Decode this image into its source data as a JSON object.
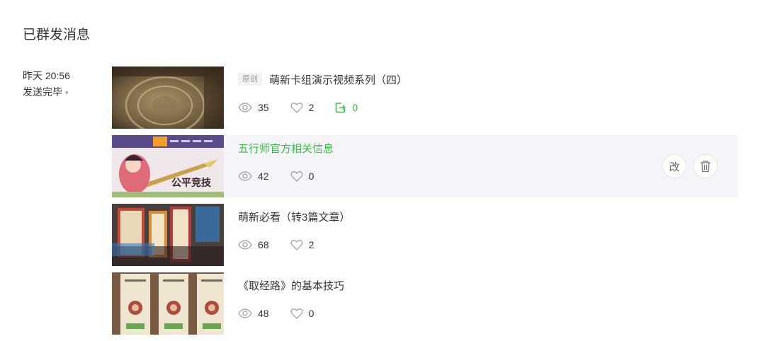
{
  "page": {
    "title": "已群发消息"
  },
  "meta": {
    "time": "昨天 20:56",
    "status": "发送完毕"
  },
  "articles": [
    {
      "tag": "原创",
      "title": "萌新卡组演示视频系列（四）",
      "views": "35",
      "likes": "2",
      "shares": "0"
    },
    {
      "title": "五行师官方相关信息",
      "views": "42",
      "likes": "0",
      "edit_label": "改"
    },
    {
      "title": "萌新必看（转3篇文章）",
      "views": "68",
      "likes": "2"
    },
    {
      "title": "《取经路》的基本技巧",
      "views": "48",
      "likes": "0"
    }
  ],
  "thumbnails": [
    {
      "text": ""
    },
    {
      "text": "公平竞技"
    },
    {
      "text": ""
    },
    {
      "text": ""
    }
  ],
  "colors": {
    "accent": "#44b549",
    "text": "#353535",
    "muted": "#9a9a9a",
    "hover_bg": "#f4f5f9"
  }
}
